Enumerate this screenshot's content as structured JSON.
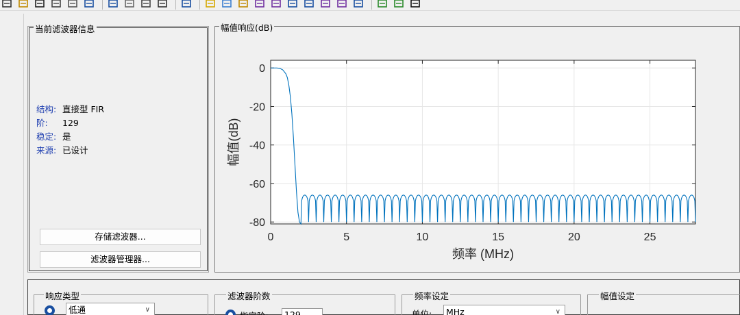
{
  "toolbar": {
    "icons": [
      "new-icon",
      "open-icon",
      "save-icon",
      "print-icon",
      "print-preview-icon",
      "zoom-in-icon",
      "zoom-out-icon",
      "pan-icon",
      "fit-icon",
      "new-window-icon",
      "filter-info-icon",
      "magnitude-response-icon",
      "phase-response-icon",
      "magnitude-phase-icon",
      "group-delay-icon",
      "phase-delay-icon",
      "impulse-response-icon",
      "step-response-icon",
      "pole-zero-icon",
      "coefficients-icon",
      "info-icon",
      "filter-spec-icon",
      "cascade-icon",
      "whats-this-icon"
    ]
  },
  "info_panel": {
    "title": "当前滤波器信息",
    "rows": [
      {
        "key": "结构:",
        "value": "直接型 FIR"
      },
      {
        "key": "阶:",
        "value": "129"
      },
      {
        "key": "稳定:",
        "value": "是"
      },
      {
        "key": "来源:",
        "value": "已设计"
      }
    ],
    "store_button": "存储滤波器...",
    "manager_button": "滤波器管理器..."
  },
  "plot_panel": {
    "title": "幅值响应(dB)"
  },
  "chart_data": {
    "type": "line",
    "xlabel": "频率 (MHz)",
    "ylabel": "幅值(dB)",
    "xlim": [
      0,
      28
    ],
    "ylim": [
      -81,
      4
    ],
    "xticks": [
      0,
      5,
      10,
      15,
      20,
      25
    ],
    "yticks": [
      0,
      -20,
      -40,
      -60,
      -80
    ],
    "xtick_labels": [
      "0",
      "5",
      "10",
      "15",
      "20",
      "25"
    ],
    "ytick_labels": [
      "0",
      "-20",
      "-40",
      "-60",
      "-80"
    ],
    "grid": true,
    "color": "#0072bd",
    "series": [
      {
        "passband": {
          "x": [
            0,
            0.2,
            0.4,
            0.6,
            0.8,
            1.0,
            1.1,
            1.2,
            1.3,
            1.4,
            1.5,
            1.6,
            1.7,
            1.8,
            1.9,
            2.0
          ],
          "y": [
            0,
            0,
            0,
            -0.2,
            -1,
            -3,
            -5,
            -9,
            -15,
            -24,
            -36,
            -50,
            -64,
            -75,
            -80,
            -81
          ]
        },
        "stopband": {
          "start": 2.0,
          "end": 28,
          "lobes": 52,
          "peak": -66,
          "floor": -80
        }
      }
    ]
  },
  "bottom": {
    "response_type": {
      "title": "响应类型",
      "selected": "低通"
    },
    "filter_order": {
      "title": "滤波器阶数",
      "option": "指定阶:",
      "value": "129"
    },
    "freq_spec": {
      "title": "频率设定",
      "unit_label": "单位:",
      "unit_value": "MHz"
    },
    "mag_spec": {
      "title": "幅值设定"
    }
  }
}
